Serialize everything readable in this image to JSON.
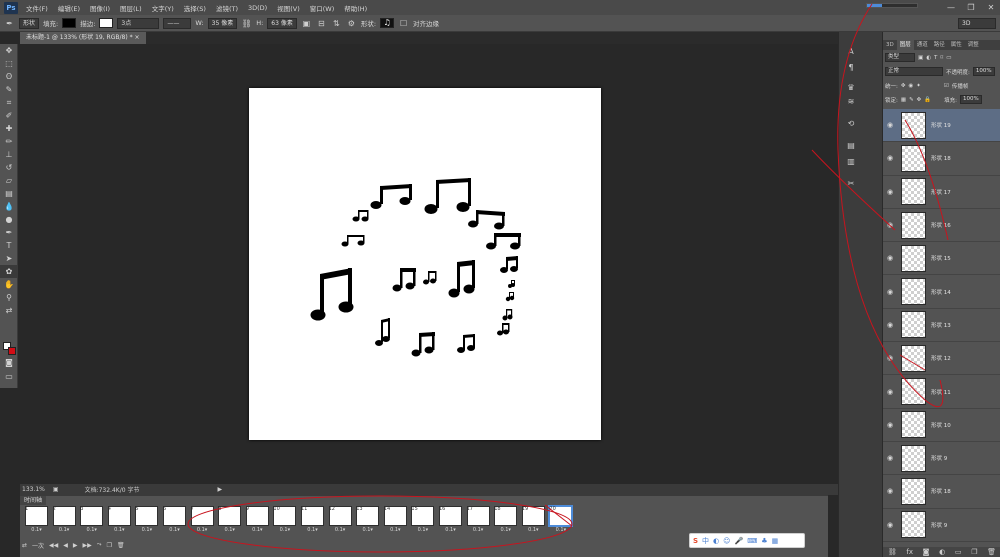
{
  "app": {
    "logo": "Ps"
  },
  "menu": [
    "文件(F)",
    "编辑(E)",
    "图像(I)",
    "图层(L)",
    "文字(Y)",
    "选择(S)",
    "滤镜(T)",
    "3D(D)",
    "视图(V)",
    "窗口(W)",
    "帮助(H)"
  ],
  "window_controls": {
    "minimize": "—",
    "maximize": "❐",
    "close": "✕"
  },
  "options_bar": {
    "shape_mode": "形状",
    "fill_label": "填充:",
    "stroke_label": "描边:",
    "stroke_size": "3点",
    "w_label": "W:",
    "w_value": "35 像素",
    "h_label": "H:",
    "h_value": "63 像素",
    "shape_label": "形状:",
    "align_edges": "对齐边缘",
    "workspace": "3D",
    "fill_color": "#000000",
    "stroke_color": "#ffffff"
  },
  "document": {
    "tab_title": "未标题-1 @ 133% (形状 19, RGB/8) *",
    "close": "×"
  },
  "status": {
    "zoom": "133.1%",
    "doc_info": "文档:732.4K/0 字节"
  },
  "timeline": {
    "title": "时间轴",
    "loop": "一次",
    "frames": [
      {
        "n": "1",
        "delay": "0.1▾"
      },
      {
        "n": "2",
        "delay": "0.1▾"
      },
      {
        "n": "3",
        "delay": "0.1▾"
      },
      {
        "n": "4",
        "delay": "0.1▾"
      },
      {
        "n": "5",
        "delay": "0.1▾"
      },
      {
        "n": "6",
        "delay": "0.1▾"
      },
      {
        "n": "7",
        "delay": "0.1▾"
      },
      {
        "n": "8",
        "delay": "0.1▾"
      },
      {
        "n": "9",
        "delay": "0.1▾"
      },
      {
        "n": "10",
        "delay": "0.1▾"
      },
      {
        "n": "11",
        "delay": "0.1▾"
      },
      {
        "n": "12",
        "delay": "0.1▾"
      },
      {
        "n": "13",
        "delay": "0.1▾"
      },
      {
        "n": "14",
        "delay": "0.1▾"
      },
      {
        "n": "15",
        "delay": "0.1▾"
      },
      {
        "n": "16",
        "delay": "0.1▾"
      },
      {
        "n": "17",
        "delay": "0.1▾"
      },
      {
        "n": "18",
        "delay": "0.1▾"
      },
      {
        "n": "19",
        "delay": "0.1▾"
      },
      {
        "n": "20",
        "delay": "0.1▾"
      }
    ],
    "selected_frame": "20"
  },
  "layers_panel": {
    "tabs": [
      "3D",
      "图层",
      "通道",
      "路径",
      "属性",
      "调整"
    ],
    "kind_filter": "类型",
    "blend_mode": "正常",
    "opacity_label": "不透明度:",
    "opacity_value": "100%",
    "unify_label": "统一:",
    "propagate_label": "传播帧",
    "lock_label": "锁定:",
    "fill_label": "填充:",
    "fill_value": "100%",
    "layers": [
      "形状 19",
      "形状 18",
      "形状 17",
      "形状 16",
      "形状 15",
      "形状 14",
      "形状 13",
      "形状 12",
      "形状 11",
      "形状 10",
      "形状 9",
      "形状 18",
      "形状 9"
    ],
    "active_layer": "形状 19"
  },
  "colors": {
    "foreground": "#ffffff",
    "background": "#d20d16",
    "accent": "#4d8bd8"
  }
}
